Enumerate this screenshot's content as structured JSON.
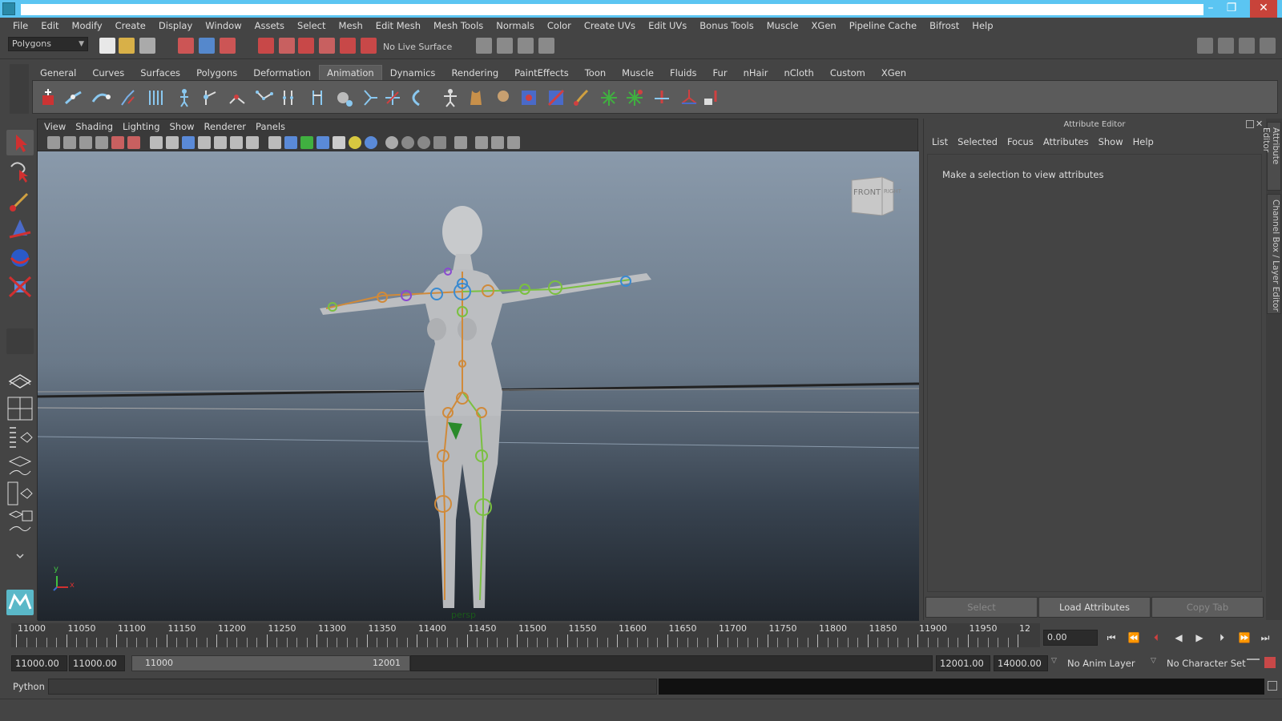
{
  "window": {
    "minimize": "–",
    "restore": "❐",
    "close": "✕"
  },
  "menubar": [
    "File",
    "Edit",
    "Modify",
    "Create",
    "Display",
    "Window",
    "Assets",
    "Select",
    "Mesh",
    "Edit Mesh",
    "Mesh Tools",
    "Normals",
    "Color",
    "Create UVs",
    "Edit UVs",
    "Bonus Tools",
    "Muscle",
    "XGen",
    "Pipeline Cache",
    "Bifrost",
    "Help"
  ],
  "statusline": {
    "mode": "Polygons",
    "live_surface": "No Live Surface"
  },
  "shelf": {
    "tabs": [
      "General",
      "Curves",
      "Surfaces",
      "Polygons",
      "Deformation",
      "Animation",
      "Dynamics",
      "Rendering",
      "PaintEffects",
      "Toon",
      "Muscle",
      "Fluids",
      "Fur",
      "nHair",
      "nCloth",
      "Custom",
      "XGen"
    ],
    "active_tab": "Animation"
  },
  "viewport": {
    "menu": [
      "View",
      "Shading",
      "Lighting",
      "Show",
      "Renderer",
      "Panels"
    ],
    "viewcube_front": "FRONT",
    "viewcube_right": "RIGHT",
    "axis_y": "y",
    "axis_x": "x",
    "camera_label": "persp"
  },
  "attribute_editor": {
    "title": "Attribute Editor",
    "menu": [
      "List",
      "Selected",
      "Focus",
      "Attributes",
      "Show",
      "Help"
    ],
    "message": "Make a selection to view attributes",
    "btn_select": "Select",
    "btn_load": "Load Attributes",
    "btn_copy": "Copy Tab"
  },
  "side_tabs": {
    "attribute_editor": "Attribute Editor",
    "channel_box": "Channel Box / Layer Editor"
  },
  "timeline": {
    "ticks": [
      "11000",
      "11050",
      "11100",
      "11150",
      "11200",
      "11250",
      "11300",
      "11350",
      "11400",
      "11450",
      "11500",
      "11550",
      "11600",
      "11650",
      "11700",
      "11750",
      "11800",
      "11850",
      "11900",
      "11950",
      "12"
    ],
    "current_time": "0.00"
  },
  "range": {
    "start_time": "11000.00",
    "playback_start": "11000.00",
    "slider_start": "11000",
    "slider_end": "12001",
    "playback_end": "12001.00",
    "end_time": "14000.00",
    "anim_layer": "No Anim Layer",
    "character_set": "No Character Set"
  },
  "cmdline": {
    "language": "Python"
  },
  "colors": {
    "titlebar": "#5bc5f2",
    "panel": "#444444",
    "joint_orange": "#d08a3a",
    "joint_green": "#7ac040",
    "joint_blue": "#3a8ad0",
    "joint_purple": "#8a4ad0"
  }
}
